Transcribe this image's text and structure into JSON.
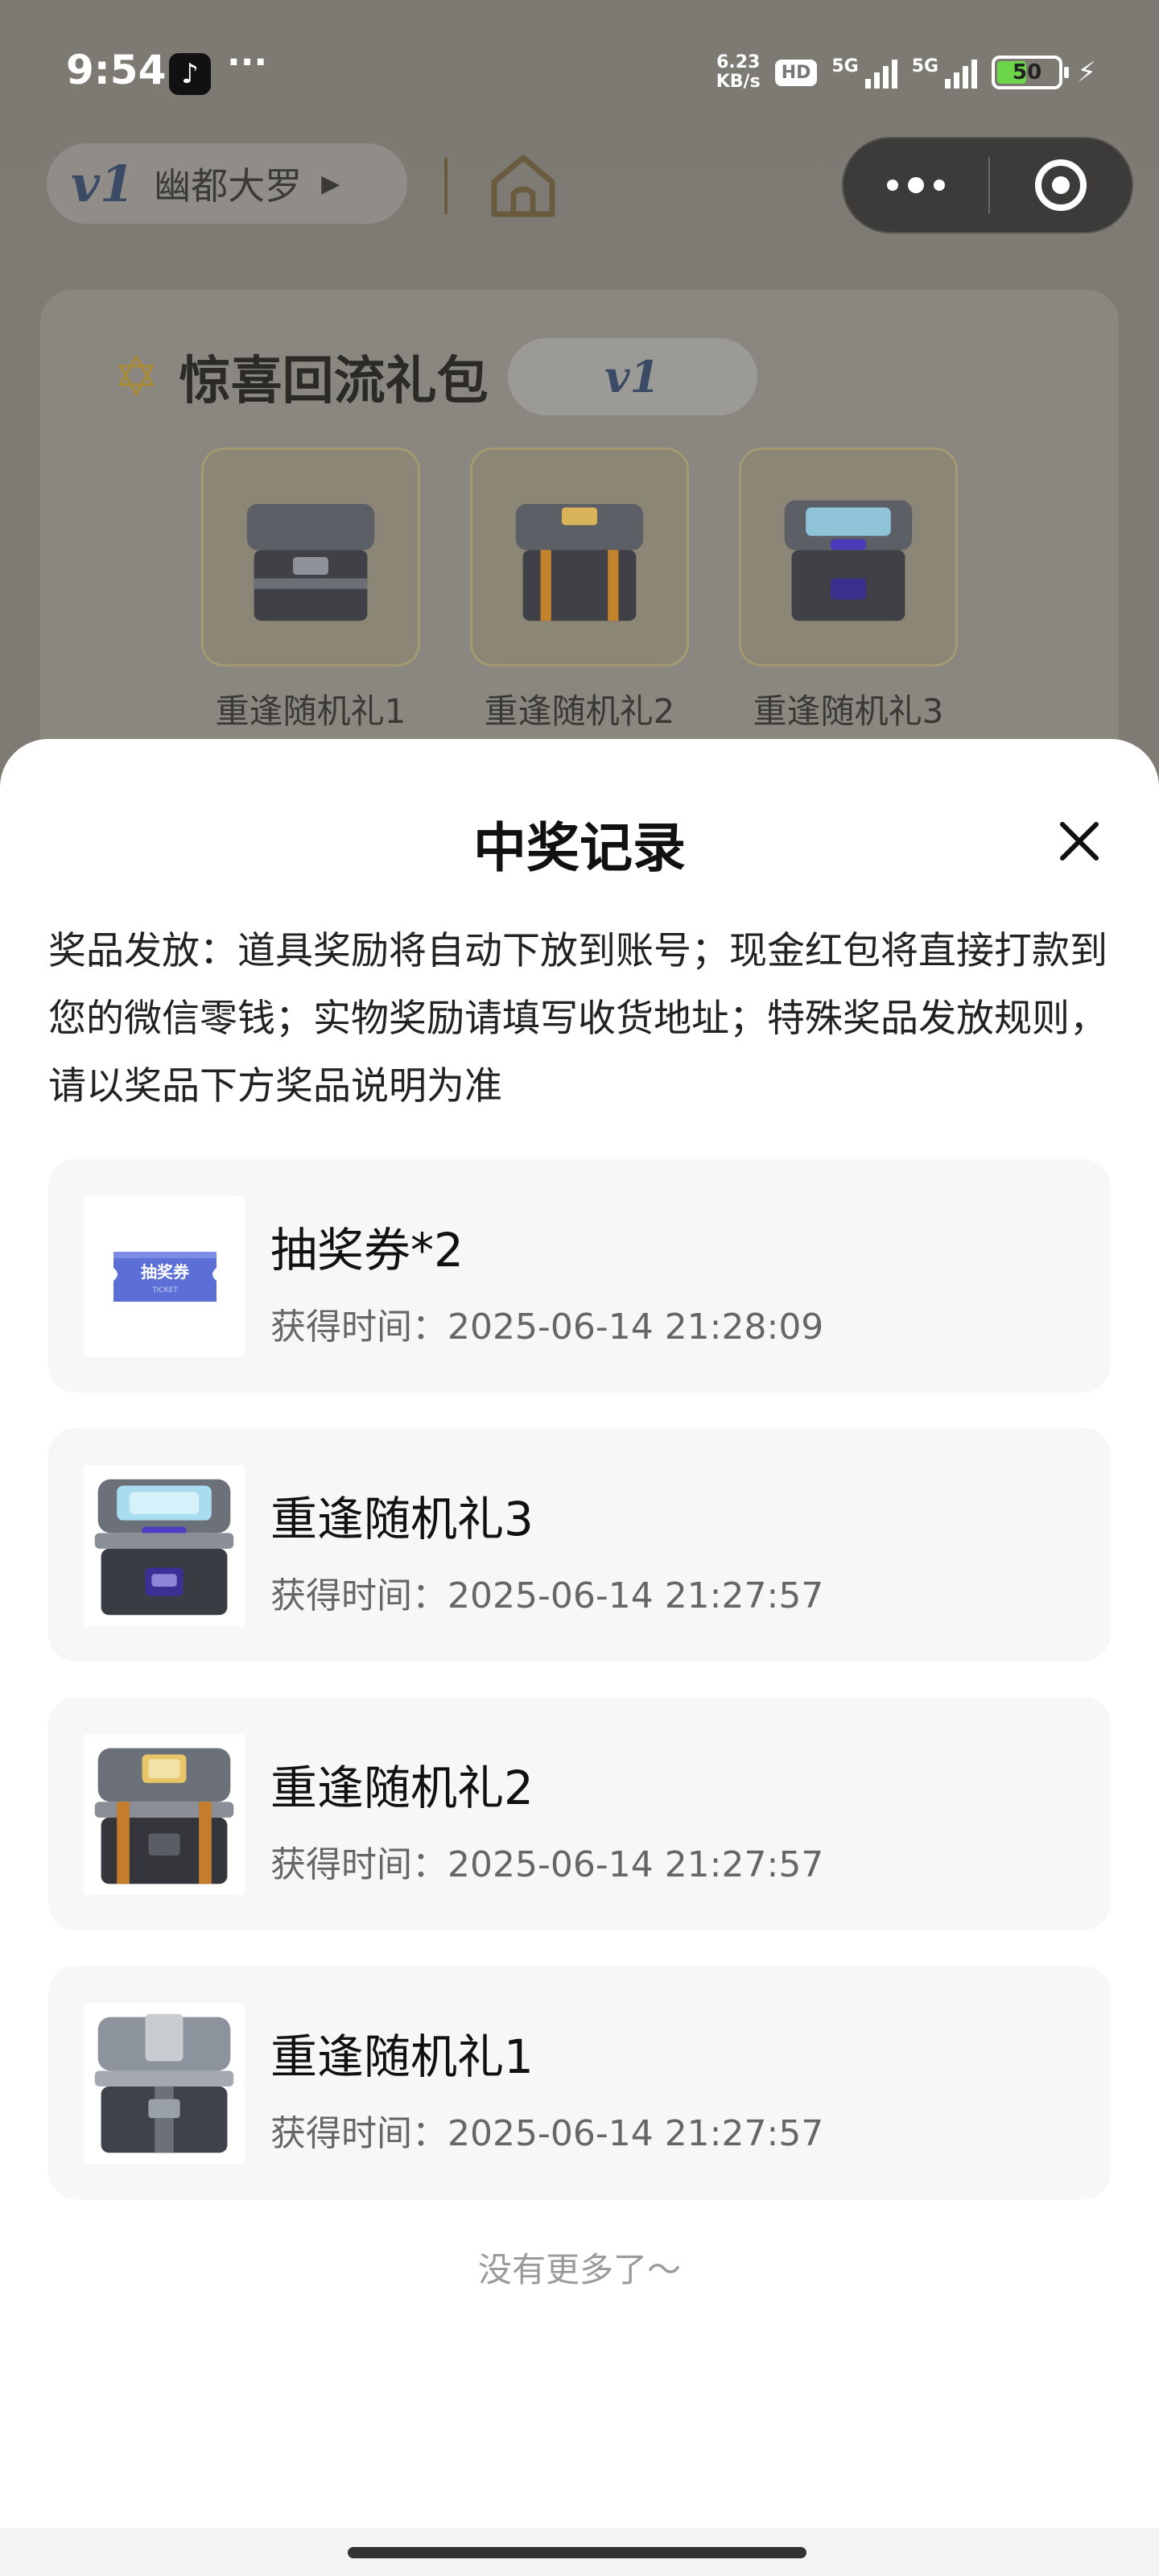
{
  "status_bar": {
    "time": "9:54",
    "more": "···",
    "net_speed_value": "6.23",
    "net_speed_unit": "KB/s",
    "hd": "HD",
    "network_1": "5G",
    "network_2": "5G",
    "battery": "50"
  },
  "header": {
    "brand_logo": "v1",
    "brand_name": "幽都大罗",
    "brand_caret": "▶"
  },
  "background_card": {
    "title": "惊喜回流礼包",
    "tag": "v1",
    "gifts": [
      {
        "label": "重逢随机礼1"
      },
      {
        "label": "重逢随机礼2"
      },
      {
        "label": "重逢随机礼3"
      }
    ]
  },
  "modal": {
    "title": "中奖记录",
    "description": "奖品发放：道具奖励将自动下放到账号；现金红包将直接打款到您的微信零钱；实物奖励请填写收货地址；特殊奖品发放规则，请以奖品下方奖品说明为准",
    "records": [
      {
        "name": "抽奖券*2",
        "time": "获得时间：2025-06-14 21:28:09",
        "thumb": "ticket",
        "ticket_text": "抽奖券",
        "ticket_sub": "TICKET"
      },
      {
        "name": "重逢随机礼3",
        "time": "获得时间：2025-06-14 21:27:57",
        "thumb": "chest-purple"
      },
      {
        "name": "重逢随机礼2",
        "time": "获得时间：2025-06-14 21:27:57",
        "thumb": "chest-orange"
      },
      {
        "name": "重逢随机礼1",
        "time": "获得时间：2025-06-14 21:27:57",
        "thumb": "chest-silver"
      }
    ],
    "no_more": "没有更多了～"
  },
  "colors": {
    "overlay_bg": "#7a7670",
    "sheet_bg": "#ffffff",
    "card_bg": "#f7f7f7",
    "accent_blue": "#5b6fd6"
  }
}
